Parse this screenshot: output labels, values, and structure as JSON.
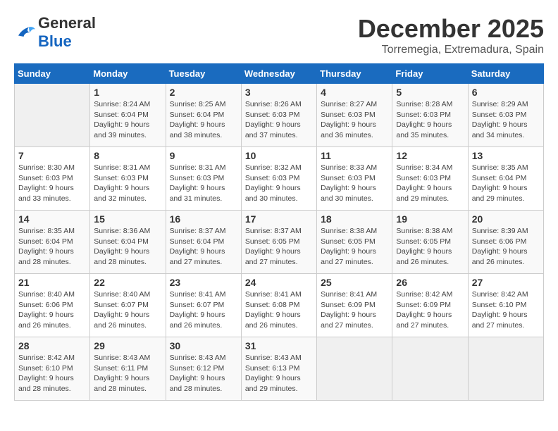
{
  "header": {
    "logo_general": "General",
    "logo_blue": "Blue",
    "month": "December 2025",
    "location": "Torremegia, Extremadura, Spain"
  },
  "weekdays": [
    "Sunday",
    "Monday",
    "Tuesday",
    "Wednesday",
    "Thursday",
    "Friday",
    "Saturday"
  ],
  "weeks": [
    [
      {
        "day": "",
        "info": ""
      },
      {
        "day": "1",
        "info": "Sunrise: 8:24 AM\nSunset: 6:04 PM\nDaylight: 9 hours\nand 39 minutes."
      },
      {
        "day": "2",
        "info": "Sunrise: 8:25 AM\nSunset: 6:04 PM\nDaylight: 9 hours\nand 38 minutes."
      },
      {
        "day": "3",
        "info": "Sunrise: 8:26 AM\nSunset: 6:03 PM\nDaylight: 9 hours\nand 37 minutes."
      },
      {
        "day": "4",
        "info": "Sunrise: 8:27 AM\nSunset: 6:03 PM\nDaylight: 9 hours\nand 36 minutes."
      },
      {
        "day": "5",
        "info": "Sunrise: 8:28 AM\nSunset: 6:03 PM\nDaylight: 9 hours\nand 35 minutes."
      },
      {
        "day": "6",
        "info": "Sunrise: 8:29 AM\nSunset: 6:03 PM\nDaylight: 9 hours\nand 34 minutes."
      }
    ],
    [
      {
        "day": "7",
        "info": "Sunrise: 8:30 AM\nSunset: 6:03 PM\nDaylight: 9 hours\nand 33 minutes."
      },
      {
        "day": "8",
        "info": "Sunrise: 8:31 AM\nSunset: 6:03 PM\nDaylight: 9 hours\nand 32 minutes."
      },
      {
        "day": "9",
        "info": "Sunrise: 8:31 AM\nSunset: 6:03 PM\nDaylight: 9 hours\nand 31 minutes."
      },
      {
        "day": "10",
        "info": "Sunrise: 8:32 AM\nSunset: 6:03 PM\nDaylight: 9 hours\nand 30 minutes."
      },
      {
        "day": "11",
        "info": "Sunrise: 8:33 AM\nSunset: 6:03 PM\nDaylight: 9 hours\nand 30 minutes."
      },
      {
        "day": "12",
        "info": "Sunrise: 8:34 AM\nSunset: 6:03 PM\nDaylight: 9 hours\nand 29 minutes."
      },
      {
        "day": "13",
        "info": "Sunrise: 8:35 AM\nSunset: 6:04 PM\nDaylight: 9 hours\nand 29 minutes."
      }
    ],
    [
      {
        "day": "14",
        "info": "Sunrise: 8:35 AM\nSunset: 6:04 PM\nDaylight: 9 hours\nand 28 minutes."
      },
      {
        "day": "15",
        "info": "Sunrise: 8:36 AM\nSunset: 6:04 PM\nDaylight: 9 hours\nand 28 minutes."
      },
      {
        "day": "16",
        "info": "Sunrise: 8:37 AM\nSunset: 6:04 PM\nDaylight: 9 hours\nand 27 minutes."
      },
      {
        "day": "17",
        "info": "Sunrise: 8:37 AM\nSunset: 6:05 PM\nDaylight: 9 hours\nand 27 minutes."
      },
      {
        "day": "18",
        "info": "Sunrise: 8:38 AM\nSunset: 6:05 PM\nDaylight: 9 hours\nand 27 minutes."
      },
      {
        "day": "19",
        "info": "Sunrise: 8:38 AM\nSunset: 6:05 PM\nDaylight: 9 hours\nand 26 minutes."
      },
      {
        "day": "20",
        "info": "Sunrise: 8:39 AM\nSunset: 6:06 PM\nDaylight: 9 hours\nand 26 minutes."
      }
    ],
    [
      {
        "day": "21",
        "info": "Sunrise: 8:40 AM\nSunset: 6:06 PM\nDaylight: 9 hours\nand 26 minutes."
      },
      {
        "day": "22",
        "info": "Sunrise: 8:40 AM\nSunset: 6:07 PM\nDaylight: 9 hours\nand 26 minutes."
      },
      {
        "day": "23",
        "info": "Sunrise: 8:41 AM\nSunset: 6:07 PM\nDaylight: 9 hours\nand 26 minutes."
      },
      {
        "day": "24",
        "info": "Sunrise: 8:41 AM\nSunset: 6:08 PM\nDaylight: 9 hours\nand 26 minutes."
      },
      {
        "day": "25",
        "info": "Sunrise: 8:41 AM\nSunset: 6:09 PM\nDaylight: 9 hours\nand 27 minutes."
      },
      {
        "day": "26",
        "info": "Sunrise: 8:42 AM\nSunset: 6:09 PM\nDaylight: 9 hours\nand 27 minutes."
      },
      {
        "day": "27",
        "info": "Sunrise: 8:42 AM\nSunset: 6:10 PM\nDaylight: 9 hours\nand 27 minutes."
      }
    ],
    [
      {
        "day": "28",
        "info": "Sunrise: 8:42 AM\nSunset: 6:10 PM\nDaylight: 9 hours\nand 28 minutes."
      },
      {
        "day": "29",
        "info": "Sunrise: 8:43 AM\nSunset: 6:11 PM\nDaylight: 9 hours\nand 28 minutes."
      },
      {
        "day": "30",
        "info": "Sunrise: 8:43 AM\nSunset: 6:12 PM\nDaylight: 9 hours\nand 28 minutes."
      },
      {
        "day": "31",
        "info": "Sunrise: 8:43 AM\nSunset: 6:13 PM\nDaylight: 9 hours\nand 29 minutes."
      },
      {
        "day": "",
        "info": ""
      },
      {
        "day": "",
        "info": ""
      },
      {
        "day": "",
        "info": ""
      }
    ]
  ]
}
